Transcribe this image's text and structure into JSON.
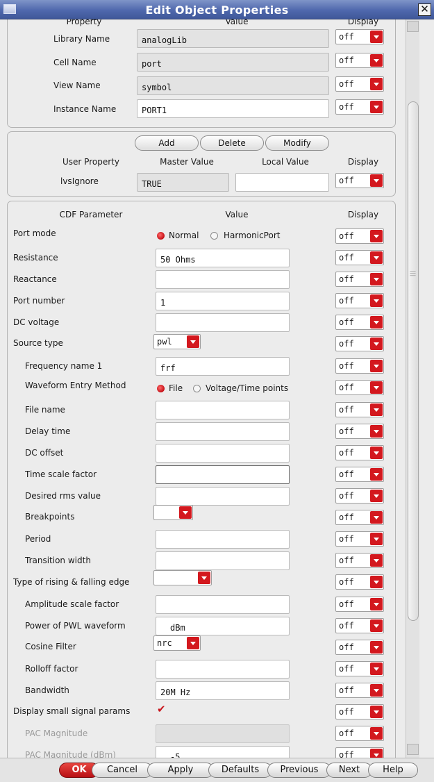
{
  "window": {
    "title": "Edit Object Properties"
  },
  "instance": {
    "headers": {
      "property": "Property",
      "value": "Value",
      "display": "Display"
    },
    "rows": [
      {
        "label": "Library Name",
        "value": "analogLib",
        "display": "off"
      },
      {
        "label": "Cell Name",
        "value": "port",
        "display": "off"
      },
      {
        "label": "View Name",
        "value": "symbol",
        "display": "off"
      },
      {
        "label": "Instance Name",
        "value": "PORT1",
        "display": "off"
      }
    ]
  },
  "user_props": {
    "buttons": {
      "add": "Add",
      "delete": "Delete",
      "modify": "Modify"
    },
    "headers": {
      "property": "User Property",
      "master": "Master Value",
      "local": "Local Value",
      "display": "Display"
    },
    "row": {
      "label": "lvsIgnore",
      "master": "TRUE",
      "local": "",
      "display": "off"
    }
  },
  "cdf": {
    "headers": {
      "param": "CDF Parameter",
      "value": "Value",
      "display": "Display"
    },
    "port_mode": {
      "label": "Port mode",
      "options": [
        "Normal",
        "HarmonicPort"
      ],
      "selected": "Normal",
      "display": "off"
    },
    "resistance": {
      "label": "Resistance",
      "value": "50 Ohms",
      "display": "off"
    },
    "reactance": {
      "label": "Reactance",
      "value": "",
      "display": "off"
    },
    "port_number": {
      "label": "Port number",
      "value": "1",
      "display": "off"
    },
    "dc_voltage": {
      "label": "DC voltage",
      "value": "",
      "display": "off"
    },
    "source_type": {
      "label": "Source type",
      "value": "pwl",
      "display": "off"
    },
    "freq_name": {
      "label": "Frequency name 1",
      "value": "frf",
      "display": "off"
    },
    "waveform_entry": {
      "label": "Waveform Entry Method",
      "options": [
        "File",
        "Voltage/Time points"
      ],
      "selected": "File",
      "display": "off"
    },
    "file_name": {
      "label": "File name",
      "value": "",
      "display": "off"
    },
    "delay_time": {
      "label": "Delay time",
      "value": "",
      "display": "off"
    },
    "dc_offset": {
      "label": "DC offset",
      "value": "",
      "display": "off"
    },
    "time_scale": {
      "label": "Time scale factor",
      "value": "",
      "display": "off"
    },
    "desired_rms": {
      "label": "Desired rms value",
      "value": "",
      "display": "off"
    },
    "breakpoints": {
      "label": "Breakpoints",
      "value": "",
      "display": "off"
    },
    "period": {
      "label": "Period",
      "value": "",
      "display": "off"
    },
    "transition_width": {
      "label": "Transition width",
      "value": "",
      "display": "off"
    },
    "edge_type": {
      "label": "Type of rising & falling edge",
      "value": "",
      "display": "off"
    },
    "amp_scale": {
      "label": "Amplitude scale factor",
      "value": "",
      "display": "off"
    },
    "pwl_power": {
      "label": "Power of PWL waveform",
      "value": "dBm",
      "display": "off"
    },
    "cosine_filter": {
      "label": "Cosine Filter",
      "value": "nrc",
      "display": "off"
    },
    "rolloff": {
      "label": "Rolloff factor",
      "value": "",
      "display": "off"
    },
    "bandwidth": {
      "label": "Bandwidth",
      "value": "20M Hz",
      "display": "off"
    },
    "small_signal": {
      "label": "Display small signal params",
      "checked": true,
      "display": "off"
    },
    "pac_mag": {
      "label": "PAC Magnitude",
      "value": "",
      "display": "off"
    },
    "pac_mag_dbm": {
      "label": "PAC Magnitude (dBm)",
      "value": "-5",
      "display": "off"
    }
  },
  "footer": {
    "ok": "OK",
    "cancel": "Cancel",
    "apply": "Apply",
    "defaults": "Defaults",
    "previous": "Previous",
    "next": "Next",
    "help": "Help"
  },
  "colors": {
    "accent": "#d3181e",
    "title_bar": "#4f68ad"
  }
}
